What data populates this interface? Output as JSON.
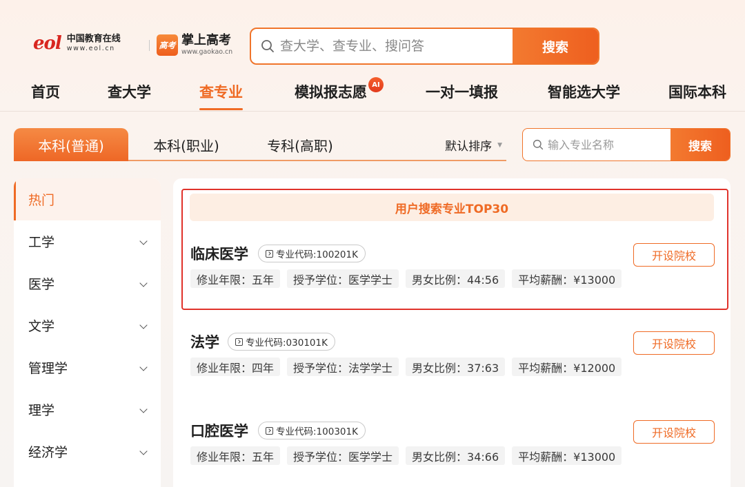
{
  "header": {
    "eol_logo": {
      "mark": "eol",
      "name": "中国教育在线",
      "url": "www.eol.cn"
    },
    "gk_logo": {
      "badge": "高考",
      "name": "掌上高考",
      "url": "www.gaokao.cn"
    },
    "search": {
      "placeholder": "查大学、查专业、搜问答",
      "button": "搜索"
    }
  },
  "nav": {
    "items": [
      {
        "label": "首页"
      },
      {
        "label": "查大学"
      },
      {
        "label": "查专业",
        "active": true
      },
      {
        "label": "模拟报志愿",
        "badge": "AI"
      },
      {
        "label": "一对一填报"
      },
      {
        "label": "智能选大学"
      },
      {
        "label": "国际本科"
      }
    ]
  },
  "subtabs": {
    "items": [
      {
        "label": "本科(普通)",
        "active": true
      },
      {
        "label": "本科(职业)"
      },
      {
        "label": "专科(高职)"
      }
    ],
    "sort_label": "默认排序"
  },
  "major_search": {
    "placeholder": "输入专业名称",
    "button": "搜索"
  },
  "sidebar": {
    "items": [
      {
        "label": "热门",
        "active": true
      },
      {
        "label": "工学"
      },
      {
        "label": "医学"
      },
      {
        "label": "文学"
      },
      {
        "label": "管理学"
      },
      {
        "label": "理学"
      },
      {
        "label": "经济学"
      }
    ]
  },
  "content": {
    "banner": "用户搜索专业TOP30",
    "majors": [
      {
        "name": "临床医学",
        "code": "专业代码:100201K",
        "button": "开设院校",
        "tags": [
          "修业年限：五年",
          "授予学位：医学学士",
          "男女比例：44:56",
          "平均薪酬：¥13000"
        ]
      },
      {
        "name": "法学",
        "code": "专业代码:030101K",
        "button": "开设院校",
        "tags": [
          "修业年限：四年",
          "授予学位：法学学士",
          "男女比例：37:63",
          "平均薪酬：¥12000"
        ]
      },
      {
        "name": "口腔医学",
        "code": "专业代码:100301K",
        "button": "开设院校",
        "tags": [
          "修业年限：五年",
          "授予学位：医学学士",
          "男女比例：34:66",
          "平均薪酬：¥13000"
        ]
      }
    ]
  },
  "colors": {
    "accent": "#ef6a24",
    "highlight_border": "#e0322a",
    "eol_red": "#d8261f"
  }
}
